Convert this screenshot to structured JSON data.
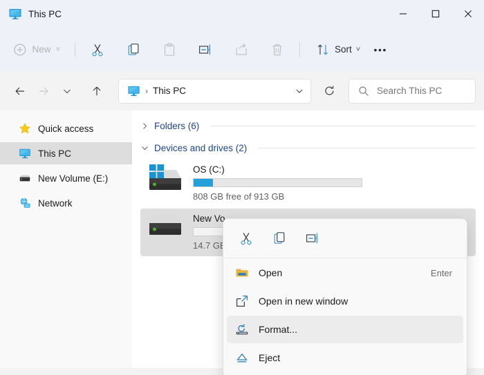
{
  "window": {
    "title": "This PC",
    "title_icon": "this-pc-monitor-icon",
    "controls": {
      "minimize": "—",
      "maximize": "□",
      "close": "✕"
    }
  },
  "toolbar": {
    "new_label": "New",
    "new_icon": "plus-circle-icon",
    "new_chevron": "˅",
    "cut_icon": "scissors-icon",
    "copy_icon": "copy-icon",
    "paste_icon": "paste-icon",
    "rename_icon": "rename-icon",
    "share_icon": "share-icon",
    "delete_icon": "trash-icon",
    "sort_label": "Sort",
    "sort_icon": "sort-arrows-icon",
    "sort_chevron": "˅",
    "more_label": "•••"
  },
  "addressbar": {
    "back_icon": "arrow-left-icon",
    "forward_icon": "arrow-right-icon",
    "recent_icon": "chevron-down-icon",
    "up_icon": "arrow-up-icon",
    "breadcrumb_icon": "this-pc-monitor-icon",
    "breadcrumb_separator": "›",
    "breadcrumb_text": "This PC",
    "breadcrumb_chevron": "˅",
    "refresh_icon": "refresh-icon",
    "search_icon": "search-icon",
    "search_placeholder": "Search This PC",
    "search_value": ""
  },
  "sidebar": {
    "items": [
      {
        "label": "Quick access",
        "icon": "star-icon",
        "selected": false
      },
      {
        "label": "This PC",
        "icon": "monitor-icon",
        "selected": true
      },
      {
        "label": "New Volume (E:)",
        "icon": "drive-icon",
        "selected": false
      },
      {
        "label": "Network",
        "icon": "network-globe-icon",
        "selected": false
      }
    ]
  },
  "content": {
    "groups": [
      {
        "label": "Folders (6)",
        "expanded": false,
        "chevron": "›"
      },
      {
        "label": "Devices and drives (2)",
        "expanded": true,
        "chevron": "˅"
      }
    ],
    "drives": [
      {
        "name": "OS (C:)",
        "icon": "windows-drive-icon",
        "used_percent": 11.5,
        "usage_text": "808 GB free of 913 GB",
        "selected": false
      },
      {
        "name": "New Vo",
        "icon": "drive-icon",
        "used_percent": 0,
        "usage_text": "14.7 GB",
        "selected": true
      }
    ]
  },
  "context_menu": {
    "top_actions": [
      {
        "name": "cut",
        "icon": "scissors-icon"
      },
      {
        "name": "copy",
        "icon": "copy-icon"
      },
      {
        "name": "rename",
        "icon": "rename-icon"
      }
    ],
    "items": [
      {
        "label": "Open",
        "icon": "folder-icon",
        "accel": "Enter",
        "highlighted": false
      },
      {
        "label": "Open in new window",
        "icon": "open-new-window-icon",
        "accel": "",
        "highlighted": false
      },
      {
        "label": "Format...",
        "icon": "format-disk-icon",
        "accel": "",
        "highlighted": true
      },
      {
        "label": "Eject",
        "icon": "eject-icon",
        "accel": "",
        "highlighted": false
      }
    ]
  },
  "colors": {
    "accent_blue": "#26a0da",
    "titlebar_bg": "#eef1f8",
    "selection_gray": "#dedede",
    "group_header": "#20478a"
  }
}
